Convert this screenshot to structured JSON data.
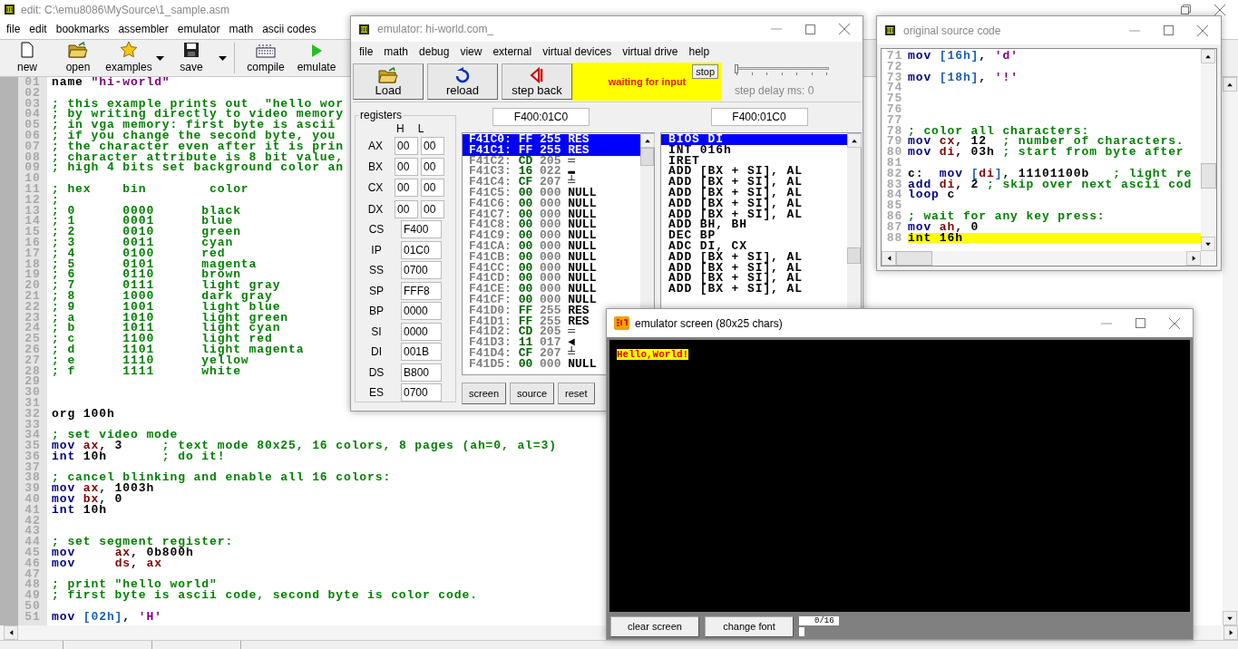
{
  "editor": {
    "title": "edit: C:\\emu8086\\MySource\\1_sample.asm",
    "menu": [
      "file",
      "edit",
      "bookmarks",
      "assembler",
      "emulator",
      "math",
      "ascii codes"
    ],
    "toolbar": [
      {
        "kind": "new",
        "label": "new",
        "dropdown": false
      },
      {
        "kind": "open",
        "label": "open",
        "dropdown": false
      },
      {
        "kind": "examples",
        "label": "examples",
        "dropdown": true
      },
      {
        "kind": "save",
        "label": "save",
        "dropdown": true
      },
      {
        "kind": "compile",
        "label": "compile",
        "dropdown": false
      },
      {
        "kind": "emulate",
        "label": "emulate",
        "dropdown": false
      }
    ],
    "lines": [
      {
        "n": "01",
        "tokens": [
          {
            "kind": "plain",
            "text": "name "
          },
          {
            "kind": "string",
            "text": "\"hi-world\""
          }
        ]
      },
      {
        "n": "02"
      },
      {
        "n": "03",
        "tokens": [
          {
            "kind": "comment",
            "text": "; this example prints out  \"hello wor"
          }
        ]
      },
      {
        "n": "04",
        "tokens": [
          {
            "kind": "comment",
            "text": "; by writing directly to video memory"
          }
        ]
      },
      {
        "n": "05",
        "tokens": [
          {
            "kind": "comment",
            "text": "; in vga memory: first byte is ascii"
          }
        ]
      },
      {
        "n": "06",
        "tokens": [
          {
            "kind": "comment",
            "text": "; if you change the second byte, you"
          }
        ]
      },
      {
        "n": "07",
        "tokens": [
          {
            "kind": "comment",
            "text": "; the character even after it is prin"
          }
        ]
      },
      {
        "n": "08",
        "tokens": [
          {
            "kind": "comment",
            "text": "; character attribute is 8 bit value,"
          }
        ]
      },
      {
        "n": "09",
        "tokens": [
          {
            "kind": "comment",
            "text": "; high 4 bits set background color an"
          }
        ]
      },
      {
        "n": "10"
      },
      {
        "n": "11",
        "tokens": [
          {
            "kind": "comment",
            "text": "; hex    bin        color"
          }
        ]
      },
      {
        "n": "12",
        "tokens": [
          {
            "kind": "comment",
            "text": ";"
          }
        ]
      },
      {
        "n": "13",
        "tokens": [
          {
            "kind": "comment",
            "text": "; 0      0000      black"
          }
        ]
      },
      {
        "n": "14",
        "tokens": [
          {
            "kind": "comment",
            "text": "; 1      0001      blue"
          }
        ]
      },
      {
        "n": "15",
        "tokens": [
          {
            "kind": "comment",
            "text": "; 2      0010      green"
          }
        ]
      },
      {
        "n": "16",
        "tokens": [
          {
            "kind": "comment",
            "text": "; 3      0011      cyan"
          }
        ]
      },
      {
        "n": "17",
        "tokens": [
          {
            "kind": "comment",
            "text": "; 4      0100      red"
          }
        ]
      },
      {
        "n": "18",
        "tokens": [
          {
            "kind": "comment",
            "text": "; 5      0101      magenta"
          }
        ]
      },
      {
        "n": "19",
        "tokens": [
          {
            "kind": "comment",
            "text": "; 6      0110      brown"
          }
        ]
      },
      {
        "n": "20",
        "tokens": [
          {
            "kind": "comment",
            "text": "; 7      0111      light gray"
          }
        ]
      },
      {
        "n": "21",
        "tokens": [
          {
            "kind": "comment",
            "text": "; 8      1000      dark gray"
          }
        ]
      },
      {
        "n": "22",
        "tokens": [
          {
            "kind": "comment",
            "text": "; 9      1001      light blue"
          }
        ]
      },
      {
        "n": "23",
        "tokens": [
          {
            "kind": "comment",
            "text": "; a      1010      light green"
          }
        ]
      },
      {
        "n": "24",
        "tokens": [
          {
            "kind": "comment",
            "text": "; b      1011      light cyan"
          }
        ]
      },
      {
        "n": "25",
        "tokens": [
          {
            "kind": "comment",
            "text": "; c      1100      light red"
          }
        ]
      },
      {
        "n": "26",
        "tokens": [
          {
            "kind": "comment",
            "text": "; d      1101      light magenta"
          }
        ]
      },
      {
        "n": "27",
        "tokens": [
          {
            "kind": "comment",
            "text": "; e      1110      yellow"
          }
        ]
      },
      {
        "n": "28",
        "tokens": [
          {
            "kind": "comment",
            "text": "; f      1111      white"
          }
        ]
      },
      {
        "n": "29"
      },
      {
        "n": "30"
      },
      {
        "n": "31"
      },
      {
        "n": "32",
        "tokens": [
          {
            "kind": "plain",
            "text": "org 100h"
          }
        ]
      },
      {
        "n": "33"
      },
      {
        "n": "34",
        "tokens": [
          {
            "kind": "comment",
            "text": "; set video mode"
          }
        ]
      },
      {
        "n": "35",
        "tokens": [
          {
            "kind": "keyword",
            "text": "mov "
          },
          {
            "kind": "register",
            "text": "ax"
          },
          {
            "kind": "plain",
            "text": ", 3     "
          },
          {
            "kind": "comment",
            "text": "; text mode 80x25, 16 colors, 8 pages (ah=0, al=3)"
          }
        ]
      },
      {
        "n": "36",
        "tokens": [
          {
            "kind": "keyword",
            "text": "int "
          },
          {
            "kind": "plain",
            "text": "10h       "
          },
          {
            "kind": "comment",
            "text": "; do it!"
          }
        ]
      },
      {
        "n": "37"
      },
      {
        "n": "38",
        "tokens": [
          {
            "kind": "comment",
            "text": "; cancel blinking and enable all 16 colors:"
          }
        ]
      },
      {
        "n": "39",
        "tokens": [
          {
            "kind": "keyword",
            "text": "mov "
          },
          {
            "kind": "register",
            "text": "ax"
          },
          {
            "kind": "plain",
            "text": ", 1003h"
          }
        ]
      },
      {
        "n": "40",
        "tokens": [
          {
            "kind": "keyword",
            "text": "mov "
          },
          {
            "kind": "register",
            "text": "bx"
          },
          {
            "kind": "plain",
            "text": ", 0"
          }
        ]
      },
      {
        "n": "41",
        "tokens": [
          {
            "kind": "keyword",
            "text": "int "
          },
          {
            "kind": "plain",
            "text": "10h"
          }
        ]
      },
      {
        "n": "42"
      },
      {
        "n": "43"
      },
      {
        "n": "44",
        "tokens": [
          {
            "kind": "comment",
            "text": "; set segment register:"
          }
        ]
      },
      {
        "n": "45",
        "tokens": [
          {
            "kind": "keyword",
            "text": "mov     "
          },
          {
            "kind": "register",
            "text": "ax"
          },
          {
            "kind": "plain",
            "text": ", 0b800h"
          }
        ]
      },
      {
        "n": "46",
        "tokens": [
          {
            "kind": "keyword",
            "text": "mov     "
          },
          {
            "kind": "register",
            "text": "ds"
          },
          {
            "kind": "plain",
            "text": ", "
          },
          {
            "kind": "register",
            "text": "ax"
          }
        ]
      },
      {
        "n": "47"
      },
      {
        "n": "48",
        "tokens": [
          {
            "kind": "comment",
            "text": "; print \"hello world\""
          }
        ]
      },
      {
        "n": "49",
        "tokens": [
          {
            "kind": "comment",
            "text": "; first byte is ascii code, second byte is color code."
          }
        ]
      },
      {
        "n": "50"
      },
      {
        "n": "51",
        "tokens": [
          {
            "kind": "keyword",
            "text": "mov "
          },
          {
            "kind": "address",
            "text": "[02h]"
          },
          {
            "kind": "plain",
            "text": ", "
          },
          {
            "kind": "string",
            "text": "'H'"
          }
        ]
      }
    ]
  },
  "emulator": {
    "title": "emulator: hi-world.com_",
    "menu": [
      "file",
      "math",
      "debug",
      "view",
      "external",
      "virtual devices",
      "virtual drive",
      "help"
    ],
    "toolbar": [
      {
        "kind": "load",
        "label": "Load"
      },
      {
        "kind": "reload",
        "label": "reload"
      },
      {
        "kind": "step_back",
        "label": "step back"
      }
    ],
    "status": "waiting for input",
    "stop": "stop",
    "step_delay": {
      "level": 0,
      "label": "step delay ms: 0"
    },
    "registers": {
      "label": "registers",
      "high": "H",
      "low": "L",
      "pairs": [
        {
          "name": "AX",
          "high": "00",
          "low": "00"
        },
        {
          "name": "BX",
          "high": "00",
          "low": "00"
        },
        {
          "name": "CX",
          "high": "00",
          "low": "00"
        },
        {
          "name": "DX",
          "high": "00",
          "low": "00"
        }
      ],
      "words": [
        {
          "name": "CS",
          "value": "F400"
        },
        {
          "name": "IP",
          "value": "01C0"
        },
        {
          "name": "SS",
          "value": "0700"
        },
        {
          "name": "SP",
          "value": "FFF8"
        },
        {
          "name": "BP",
          "value": "0000"
        },
        {
          "name": "SI",
          "value": "0000"
        },
        {
          "name": "DI",
          "value": "001B"
        },
        {
          "name": "DS",
          "value": "B800"
        },
        {
          "name": "ES",
          "value": "0700"
        }
      ]
    },
    "memory": {
      "address": "F400:01C0",
      "rows": [
        {
          "address": "F41C0:",
          "hex": "FF",
          "dec": "255",
          "char": "RES",
          "selected": true
        },
        {
          "address": "F41C1:",
          "hex": "FF",
          "dec": "255",
          "char": "RES",
          "selected": true
        },
        {
          "address": "F41C2:",
          "hex": "CD",
          "dec": "205",
          "char": "═",
          "selected": false
        },
        {
          "address": "F41C3:",
          "hex": "16",
          "dec": "022",
          "char": "▬",
          "selected": false
        },
        {
          "address": "F41C4:",
          "hex": "CF",
          "dec": "207",
          "char": "╧",
          "selected": false
        },
        {
          "address": "F41C5:",
          "hex": "00",
          "dec": "000",
          "char": "NULL",
          "selected": false
        },
        {
          "address": "F41C6:",
          "hex": "00",
          "dec": "000",
          "char": "NULL",
          "selected": false
        },
        {
          "address": "F41C7:",
          "hex": "00",
          "dec": "000",
          "char": "NULL",
          "selected": false
        },
        {
          "address": "F41C8:",
          "hex": "00",
          "dec": "000",
          "char": "NULL",
          "selected": false
        },
        {
          "address": "F41C9:",
          "hex": "00",
          "dec": "000",
          "char": "NULL",
          "selected": false
        },
        {
          "address": "F41CA:",
          "hex": "00",
          "dec": "000",
          "char": "NULL",
          "selected": false
        },
        {
          "address": "F41CB:",
          "hex": "00",
          "dec": "000",
          "char": "NULL",
          "selected": false
        },
        {
          "address": "F41CC:",
          "hex": "00",
          "dec": "000",
          "char": "NULL",
          "selected": false
        },
        {
          "address": "F41CD:",
          "hex": "00",
          "dec": "000",
          "char": "NULL",
          "selected": false
        },
        {
          "address": "F41CE:",
          "hex": "00",
          "dec": "000",
          "char": "NULL",
          "selected": false
        },
        {
          "address": "F41CF:",
          "hex": "00",
          "dec": "000",
          "char": "NULL",
          "selected": false
        },
        {
          "address": "F41D0:",
          "hex": "FF",
          "dec": "255",
          "char": "RES",
          "selected": false
        },
        {
          "address": "F41D1:",
          "hex": "FF",
          "dec": "255",
          "char": "RES",
          "selected": false
        },
        {
          "address": "F41D2:",
          "hex": "CD",
          "dec": "205",
          "char": "═",
          "selected": false
        },
        {
          "address": "F41D3:",
          "hex": "11",
          "dec": "017",
          "char": "◄",
          "selected": false
        },
        {
          "address": "F41D4:",
          "hex": "CF",
          "dec": "207",
          "char": "╧",
          "selected": false
        },
        {
          "address": "F41D5:",
          "hex": "00",
          "dec": "000",
          "char": "NULL",
          "selected": false
        }
      ]
    },
    "disassembly": {
      "address": "F400:01C0",
      "rows": [
        {
          "text": "BIOS DI",
          "selected": true
        },
        {
          "text": "INT 016h",
          "selected": false
        },
        {
          "text": "IRET",
          "selected": false
        },
        {
          "text": "ADD [BX + SI], AL",
          "selected": false
        },
        {
          "text": "ADD [BX + SI], AL",
          "selected": false
        },
        {
          "text": "ADD [BX + SI], AL",
          "selected": false
        },
        {
          "text": "ADD [BX + SI], AL",
          "selected": false
        },
        {
          "text": "ADD [BX + SI], AL",
          "selected": false
        },
        {
          "text": "ADD BH, BH",
          "selected": false
        },
        {
          "text": "DEC BP",
          "selected": false
        },
        {
          "text": "ADC DI, CX",
          "selected": false
        },
        {
          "text": "ADD [BX + SI], AL",
          "selected": false
        },
        {
          "text": "ADD [BX + SI], AL",
          "selected": false
        },
        {
          "text": "ADD [BX + SI], AL",
          "selected": false
        },
        {
          "text": "ADD [BX + SI], AL",
          "selected": false
        }
      ]
    },
    "buttons": [
      "screen",
      "source",
      "reset"
    ]
  },
  "source_window": {
    "title": "original source code",
    "lines": [
      {
        "n": "71",
        "tokens": [
          {
            "kind": "keyword",
            "text": "mov "
          },
          {
            "kind": "address",
            "text": "[16h]"
          },
          {
            "kind": "plain",
            "text": ", "
          },
          {
            "kind": "string",
            "text": "'d'"
          }
        ],
        "highlighted": false
      },
      {
        "n": "72"
      },
      {
        "n": "73",
        "tokens": [
          {
            "kind": "keyword",
            "text": "mov "
          },
          {
            "kind": "address",
            "text": "[18h]"
          },
          {
            "kind": "plain",
            "text": ", "
          },
          {
            "kind": "string",
            "text": "'!'"
          }
        ],
        "highlighted": false
      },
      {
        "n": "74"
      },
      {
        "n": "75"
      },
      {
        "n": "76"
      },
      {
        "n": "77"
      },
      {
        "n": "78",
        "tokens": [
          {
            "kind": "comment",
            "text": "; color all characters:"
          }
        ],
        "highlighted": false
      },
      {
        "n": "79",
        "tokens": [
          {
            "kind": "keyword",
            "text": "mov "
          },
          {
            "kind": "register",
            "text": "cx"
          },
          {
            "kind": "plain",
            "text": ", 12  "
          },
          {
            "kind": "comment",
            "text": "; number of characters."
          }
        ],
        "highlighted": false
      },
      {
        "n": "80",
        "tokens": [
          {
            "kind": "keyword",
            "text": "mov "
          },
          {
            "kind": "register",
            "text": "di"
          },
          {
            "kind": "plain",
            "text": ", 03h "
          },
          {
            "kind": "comment",
            "text": "; start from byte after"
          }
        ],
        "highlighted": false
      },
      {
        "n": "81"
      },
      {
        "n": "82",
        "tokens": [
          {
            "kind": "plain",
            "text": "c:  "
          },
          {
            "kind": "keyword",
            "text": "mov "
          },
          {
            "kind": "address",
            "text": "["
          },
          {
            "kind": "register",
            "text": "di"
          },
          {
            "kind": "address",
            "text": "]"
          },
          {
            "kind": "plain",
            "text": ", 11101100b   "
          },
          {
            "kind": "comment",
            "text": "; light re"
          }
        ],
        "highlighted": false
      },
      {
        "n": "83",
        "tokens": [
          {
            "kind": "keyword",
            "text": "add "
          },
          {
            "kind": "register",
            "text": "di"
          },
          {
            "kind": "plain",
            "text": ", 2 "
          },
          {
            "kind": "comment",
            "text": "; skip over next ascii cod"
          }
        ],
        "highlighted": false
      },
      {
        "n": "84",
        "tokens": [
          {
            "kind": "keyword",
            "text": "loop "
          },
          {
            "kind": "plain",
            "text": "c"
          }
        ],
        "highlighted": false
      },
      {
        "n": "85"
      },
      {
        "n": "86",
        "tokens": [
          {
            "kind": "comment",
            "text": "; wait for any key press:"
          }
        ],
        "highlighted": false
      },
      {
        "n": "87",
        "tokens": [
          {
            "kind": "keyword",
            "text": "mov "
          },
          {
            "kind": "register",
            "text": "ah"
          },
          {
            "kind": "plain",
            "text": ", 0"
          }
        ],
        "highlighted": false
      },
      {
        "n": "88",
        "tokens": [
          {
            "kind": "plain",
            "text": "int 16h"
          }
        ],
        "highlighted": true
      }
    ]
  },
  "screen_window": {
    "title": "emulator screen (80x25 chars)",
    "output": "Hello,World!",
    "buttons": [
      "clear screen",
      "change font"
    ],
    "counter": "0/16"
  }
}
